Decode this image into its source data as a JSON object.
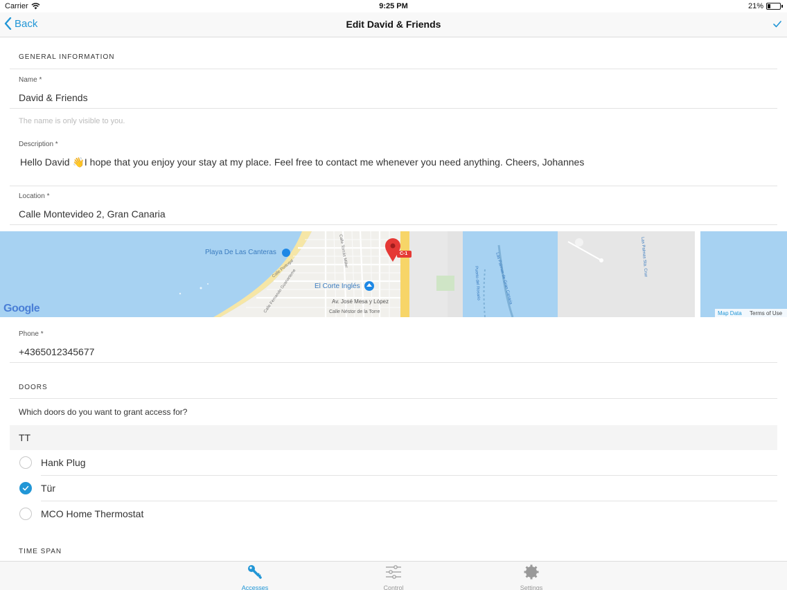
{
  "status": {
    "carrier": "Carrier",
    "time": "9:25 PM",
    "battery": "21%",
    "battery_level": 0.21
  },
  "nav": {
    "back_label": "Back",
    "title": "Edit David & Friends"
  },
  "sections": {
    "general": "GENERAL INFORMATION",
    "doors": "DOORS",
    "time_span": "TIME SPAN"
  },
  "fields": {
    "name": {
      "label": "Name *",
      "value": "David & Friends",
      "hint": "The name is only visible to you."
    },
    "description": {
      "label": "Description *",
      "value": "Hello David 👋I hope that you enjoy your stay at my place. Feel free to contact me whenever you need anything. Cheers, Johannes"
    },
    "location": {
      "label": "Location *",
      "value": "Calle Montevideo 2, Gran Canaria"
    },
    "phone": {
      "label": "Phone *",
      "value": "+4365012345677"
    }
  },
  "map": {
    "labels": [
      "Playa De Las Canteras",
      "El Corte Inglés",
      "Av. José Mesa y López",
      "Calle Néstor de la Torre",
      "Calle Portugal",
      "Calle Fernando Guanarteme",
      "Calle Tomás Miller",
      "Puerto del Rosario",
      "Las Palmas de Gran Canaria",
      "Las Palmas Sta. Cruz"
    ],
    "brand": "Google",
    "attribution_data": "Map Data",
    "attribution_terms": "Terms of Use",
    "road_badge": "C-1"
  },
  "doors": {
    "question": "Which doors do you want to grant access for?",
    "group_name": "TT",
    "items": [
      {
        "label": "Hank Plug",
        "checked": false
      },
      {
        "label": "Tür",
        "checked": true
      },
      {
        "label": "MCO Home Thermostat",
        "checked": false
      }
    ]
  },
  "tabs": [
    {
      "label": "Accesses",
      "icon": "key-icon",
      "active": true
    },
    {
      "label": "Control",
      "icon": "sliders-icon",
      "active": false
    },
    {
      "label": "Settings",
      "icon": "gear-icon",
      "active": false
    }
  ],
  "colors": {
    "accent": "#2196d6",
    "water": "#a7d2f2",
    "land": "#f1f0ec",
    "pin": "#e53935"
  }
}
